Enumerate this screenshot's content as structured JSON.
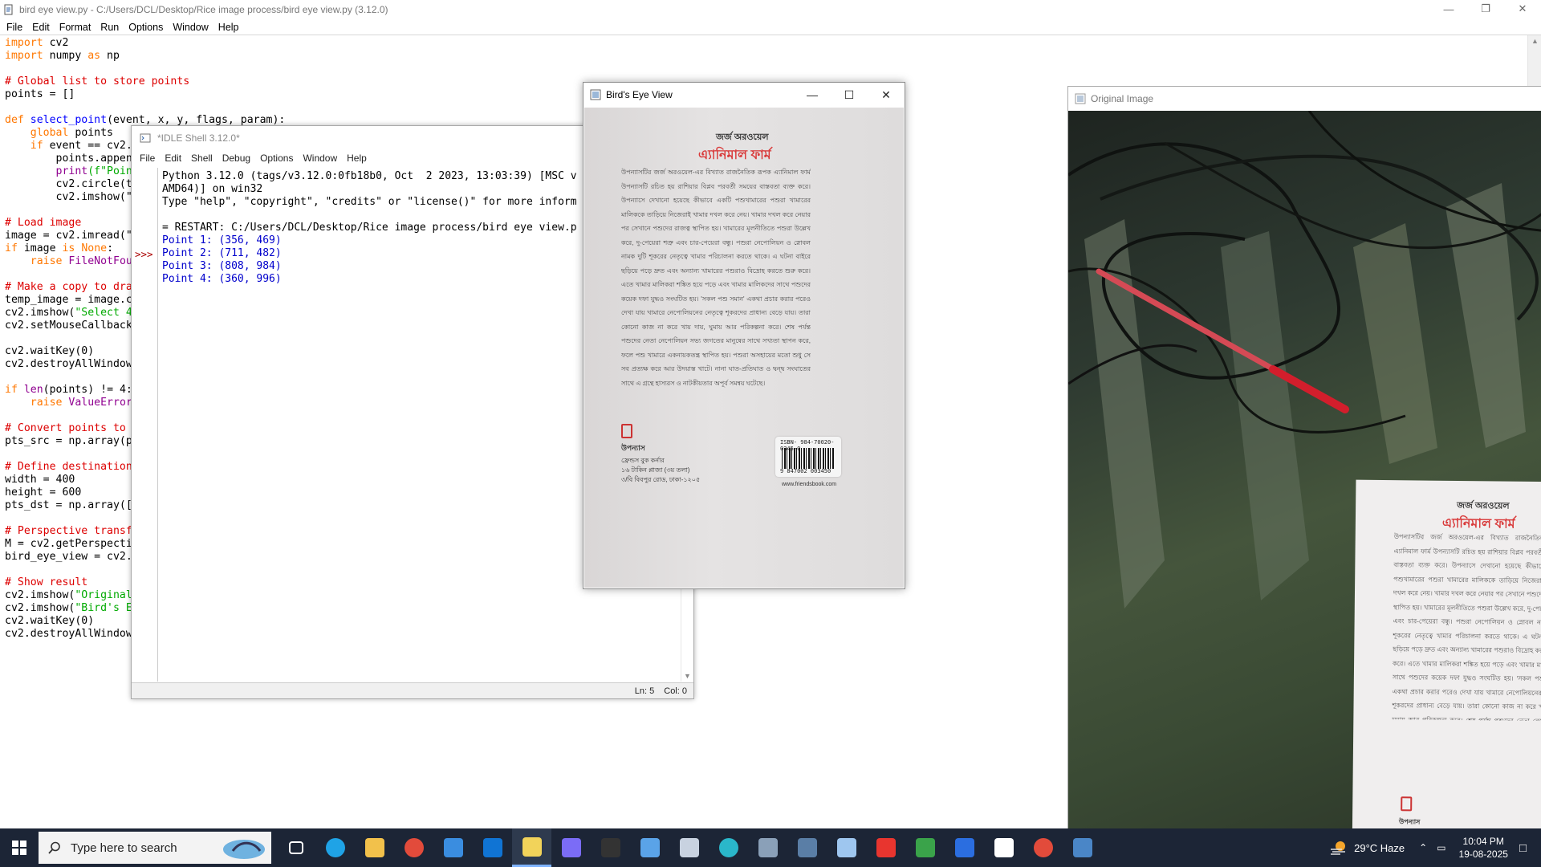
{
  "editor": {
    "title": "bird eye view.py - C:/Users/DCL/Desktop/Rice image process/bird eye view.py (3.12.0)",
    "menu": [
      "File",
      "Edit",
      "Format",
      "Run",
      "Options",
      "Window",
      "Help"
    ],
    "code_lines": [
      [
        {
          "t": "import",
          "c": "kw"
        },
        {
          "t": " cv2",
          "c": ""
        }
      ],
      [
        {
          "t": "import",
          "c": "kw"
        },
        {
          "t": " numpy ",
          "c": ""
        },
        {
          "t": "as",
          "c": "kw"
        },
        {
          "t": " np",
          "c": ""
        }
      ],
      [
        {
          "t": "",
          "c": ""
        }
      ],
      [
        {
          "t": "# Global list to store points",
          "c": "cm"
        }
      ],
      [
        {
          "t": "points = []",
          "c": ""
        }
      ],
      [
        {
          "t": "",
          "c": ""
        }
      ],
      [
        {
          "t": "def",
          "c": "kw"
        },
        {
          "t": " ",
          "c": ""
        },
        {
          "t": "select_point",
          "c": "fn"
        },
        {
          "t": "(event, x, y, flags, param):",
          "c": ""
        }
      ],
      [
        {
          "t": "    ",
          "c": ""
        },
        {
          "t": "global",
          "c": "kw"
        },
        {
          "t": " points",
          "c": ""
        }
      ],
      [
        {
          "t": "    ",
          "c": ""
        },
        {
          "t": "if",
          "c": "kw"
        },
        {
          "t": " event == cv2.",
          "c": ""
        }
      ],
      [
        {
          "t": "        points.appen",
          "c": ""
        }
      ],
      [
        {
          "t": "        ",
          "c": ""
        },
        {
          "t": "print",
          "c": "bi"
        },
        {
          "t": "(f\"Poin",
          "c": "st"
        }
      ],
      [
        {
          "t": "        cv2.circle(t",
          "c": ""
        }
      ],
      [
        {
          "t": "        cv2.imshow(\"",
          "c": ""
        }
      ],
      [
        {
          "t": "",
          "c": ""
        }
      ],
      [
        {
          "t": "# Load image",
          "c": "cm"
        }
      ],
      [
        {
          "t": "image = cv2.imread(\"",
          "c": ""
        }
      ],
      [
        {
          "t": "if",
          "c": "kw"
        },
        {
          "t": " image ",
          "c": ""
        },
        {
          "t": "is",
          "c": "kw"
        },
        {
          "t": " ",
          "c": ""
        },
        {
          "t": "None",
          "c": "kw"
        },
        {
          "t": ":",
          "c": ""
        }
      ],
      [
        {
          "t": "    ",
          "c": ""
        },
        {
          "t": "raise",
          "c": "kw"
        },
        {
          "t": " ",
          "c": ""
        },
        {
          "t": "FileNotFou",
          "c": "bi"
        }
      ],
      [
        {
          "t": "",
          "c": ""
        }
      ],
      [
        {
          "t": "# Make a copy to dra",
          "c": "cm"
        }
      ],
      [
        {
          "t": "temp_image = image.c",
          "c": ""
        }
      ],
      [
        {
          "t": "cv2.imshow(",
          "c": ""
        },
        {
          "t": "\"Select 4",
          "c": "st"
        }
      ],
      [
        {
          "t": "cv2.setMouseCallback",
          "c": ""
        }
      ],
      [
        {
          "t": "",
          "c": ""
        }
      ],
      [
        {
          "t": "cv2.waitKey(0)",
          "c": ""
        }
      ],
      [
        {
          "t": "cv2.destroyAllWindow",
          "c": ""
        }
      ],
      [
        {
          "t": "",
          "c": ""
        }
      ],
      [
        {
          "t": "if",
          "c": "kw"
        },
        {
          "t": " ",
          "c": ""
        },
        {
          "t": "len",
          "c": "bi"
        },
        {
          "t": "(points) != 4:",
          "c": ""
        }
      ],
      [
        {
          "t": "    ",
          "c": ""
        },
        {
          "t": "raise",
          "c": "kw"
        },
        {
          "t": " ",
          "c": ""
        },
        {
          "t": "ValueError",
          "c": "bi"
        }
      ],
      [
        {
          "t": "",
          "c": ""
        }
      ],
      [
        {
          "t": "# Convert points to ",
          "c": "cm"
        }
      ],
      [
        {
          "t": "pts_src = np.array(p",
          "c": ""
        }
      ],
      [
        {
          "t": "",
          "c": ""
        }
      ],
      [
        {
          "t": "# Define destination",
          "c": "cm"
        }
      ],
      [
        {
          "t": "width = 400",
          "c": ""
        }
      ],
      [
        {
          "t": "height = 600",
          "c": ""
        }
      ],
      [
        {
          "t": "pts_dst = np.array([",
          "c": ""
        }
      ],
      [
        {
          "t": "",
          "c": ""
        }
      ],
      [
        {
          "t": "# Perspective transf",
          "c": "cm"
        }
      ],
      [
        {
          "t": "M = cv2.getPerspecti",
          "c": ""
        }
      ],
      [
        {
          "t": "bird_eye_view = cv2.",
          "c": ""
        }
      ],
      [
        {
          "t": "",
          "c": ""
        }
      ],
      [
        {
          "t": "# Show result",
          "c": "cm"
        }
      ],
      [
        {
          "t": "cv2.imshow(",
          "c": ""
        },
        {
          "t": "\"Original",
          "c": "st"
        }
      ],
      [
        {
          "t": "cv2.imshow(",
          "c": ""
        },
        {
          "t": "\"Bird's E",
          "c": "st"
        }
      ],
      [
        {
          "t": "cv2.waitKey(0)",
          "c": ""
        }
      ],
      [
        {
          "t": "cv2.destroyAllWindow",
          "c": ""
        }
      ]
    ]
  },
  "shell": {
    "title": "*IDLE Shell 3.12.0*",
    "menu": [
      "File",
      "Edit",
      "Shell",
      "Debug",
      "Options",
      "Window",
      "Help"
    ],
    "prompt": ">>>",
    "lines": [
      {
        "t": "Python 3.12.0 (tags/v3.12.0:0fb18b0, Oct  2 2023, 13:03:39) [MSC v",
        "c": ""
      },
      {
        "t": "AMD64)] on win32",
        "c": ""
      },
      {
        "t": "Type \"help\", \"copyright\", \"credits\" or \"license()\" for more inform",
        "c": ""
      },
      {
        "t": "",
        "c": ""
      },
      {
        "t": "= RESTART: C:/Users/DCL/Desktop/Rice image process/bird eye view.p",
        "c": ""
      },
      {
        "t": "Point 1: (356, 469)",
        "c": "out"
      },
      {
        "t": "Point 2: (711, 482)",
        "c": "out"
      },
      {
        "t": "Point 3: (808, 984)",
        "c": "out"
      },
      {
        "t": "Point 4: (360, 996)",
        "c": "out"
      }
    ],
    "status_ln": "Ln: 5",
    "status_col": "Col: 0"
  },
  "bev": {
    "title": "Bird's Eye View",
    "author": "জর্জ অরওয়েল",
    "book_title": "এ্যানিমাল ফার্ম",
    "body": "উপন্যাসটির জর্জ অরওয়েল-এর বিখ্যাত রাজনৈতিক রূপক এ্যানিমাল ফার্ম উপন্যাসটি রচিত হয় রাশিয়ার বিপ্লব পরবর্তী সময়ের বাস্তবতা ব্যক্ত করে। উপন্যাসে দেখানো হয়েছে কীভাবে একটি পশুখামারের পশুরা খামারের মালিককে তাড়িয়ে নিজেরাই খামার দখল করে নেয়। খামার দখল করে নেয়ার পর সেখানে পশুদের রাজত্ব স্থাপিত হয়। খামারের মূলনীতিতে পশুরা উল্লেখ করে, দু-পেয়েরা শত্রু এবং চার-পেয়েরা বন্ধু। পশুরা নেপোলিয়ন ও স্নোবল নামক দুটি শূকরের নেতৃত্বে খামার পরিচালনা করতে থাকে। এ ঘটনা বাইরে ছড়িয়ে পড়ে দ্রুত এবং অন্যান্য খামারের পশুরাও বিদ্রোহ করতে শুরু করে। এতে খামার মালিকরা শঙ্কিত হয়ে পড়ে এবং খামার মালিকদের সাথে পশুদের কয়েক দফা যুদ্ধও সংঘটিত হয়। 'সকল পশু সমান' একথা প্রচার করার পরেও দেখা যায় খামারে নেপোলিয়নের নেতৃত্বে শূকরদের প্রাধান্য বেড়ে যায়। তারা কোনো কাজ না করে খায় দায়, ঘুমায় আর পরিকল্পনা করে। শেষ পর্যন্ত পশুদের নেতা নেপোলিয়ন সভ্য জগতের মানুষের সাথে সখ্যতা স্থাপন করে, ফলে পশু খামারে একনায়কতন্ত্র স্থাপিত হয়। পশুরা অসহায়ের মতো শুধু সে সব প্রত্যক্ষ করে আর উদয়াস্ত খাটে। নানা ঘাত-প্রতিঘাত ও দ্বন্দ্ব সংঘাতের সাথে এ গ্রন্থে হাস্যরস ও নাটকীয়তার অপূর্ব সমন্বয় ঘটেছে।",
    "genre": "উপন্যাস",
    "publisher": "ফ্রেন্ডস বুক কর্নার",
    "price": "১৬ টাকিন প্লাজা (৩য় তলা)",
    "address": "৩/বি বিবপুর রোড, ঢাকা-১২০৫",
    "isbn": "ISBN- 984-70020-0345-0",
    "barcode_num": "9 847002 003450",
    "website": "www.friendsbook.com"
  },
  "orig": {
    "title": "Original Image",
    "author": "জর্জ অরওয়েল",
    "book_title": "এ্যানিমাল ফার্ম",
    "genre": "উপন্যাস"
  },
  "taskbar": {
    "search_placeholder": "Type here to search",
    "weather": "29°C  Haze",
    "time": "10:04 PM",
    "date": "19-08-2025",
    "apps": [
      {
        "name": "task-view",
        "color": "#ffffff"
      },
      {
        "name": "edge",
        "color": "#1fa3e6"
      },
      {
        "name": "file-explorer",
        "color": "#f2c14b"
      },
      {
        "name": "chrome",
        "color": "#e24b3b"
      },
      {
        "name": "store",
        "color": "#3a8de0"
      },
      {
        "name": "outlook",
        "color": "#1074d4"
      },
      {
        "name": "idle-editor",
        "color": "#f2d35a"
      },
      {
        "name": "copilot",
        "color": "#7b6cf6"
      },
      {
        "name": "snipping",
        "color": "#333333"
      },
      {
        "name": "notepad",
        "color": "#5aa3e8"
      },
      {
        "name": "keyboard",
        "color": "#c8d2e0"
      },
      {
        "name": "infinity-app",
        "color": "#2ab7ca"
      },
      {
        "name": "bug-app",
        "color": "#8aa0b8"
      },
      {
        "name": "remote-desktop",
        "color": "#5a7ea6"
      },
      {
        "name": "image-viewer",
        "color": "#9ec6ef"
      },
      {
        "name": "anydesk",
        "color": "#e8352f"
      },
      {
        "name": "pycharm-like",
        "color": "#3aa34a"
      },
      {
        "name": "r-app",
        "color": "#2b6ee0"
      },
      {
        "name": "window-app",
        "color": "#ffffff"
      },
      {
        "name": "chrome-2",
        "color": "#e24b3b"
      },
      {
        "name": "python-idle",
        "color": "#4a86c7"
      }
    ]
  }
}
